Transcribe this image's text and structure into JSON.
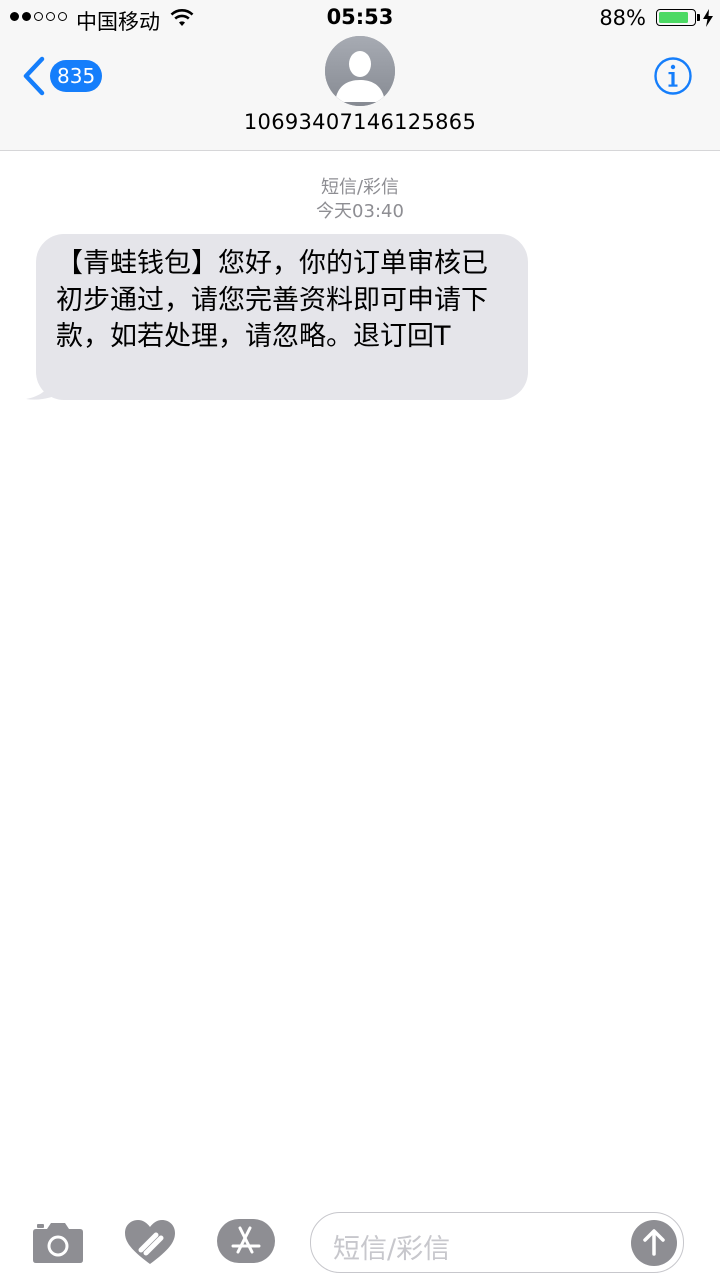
{
  "status_bar": {
    "carrier": "中国移动",
    "time": "05:53",
    "battery_percent": "88%",
    "battery_level": 0.88,
    "signal_bars_filled": 2,
    "signal_bars_total": 5
  },
  "header": {
    "back_badge": "835",
    "contact_number": "10693407146125865",
    "avatar_icon": "person-silhouette-icon",
    "info_icon": "info-icon"
  },
  "conversation": {
    "service_label": "短信/彩信",
    "timestamp": "今天03:40",
    "messages": [
      {
        "direction": "incoming",
        "text": "【青蛙钱包】您好，你的订单审核已初步通过，请您完善资料即可申请下款，如若处理，请忽略。退订回T"
      }
    ]
  },
  "input_bar": {
    "placeholder": "短信/彩信",
    "icons": [
      "camera-icon",
      "digital-touch-heart-icon",
      "app-store-icon",
      "send-arrow-icon"
    ]
  },
  "colors": {
    "accent": "#157efb",
    "incoming_bubble": "#e5e5ea",
    "meta_text": "#8e8e93",
    "battery_fill": "#4cd964"
  }
}
